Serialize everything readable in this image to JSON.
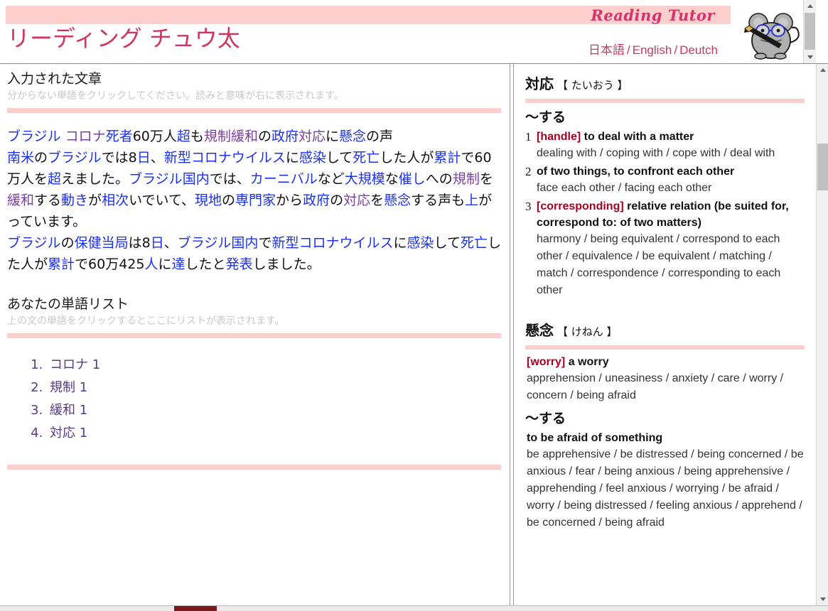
{
  "header": {
    "logo_text": "Reading Tutor",
    "site_title": "リーディング チュウ太",
    "languages": [
      {
        "label": "日本語"
      },
      {
        "label": "English"
      },
      {
        "label": "Deutch"
      }
    ],
    "lang_separator": "/",
    "mascot_name": "mouse-mascot-icon",
    "band_color": "#fbcfcb",
    "title_color": "#d0365f"
  },
  "left": {
    "input_section": {
      "title": "入力された文章",
      "hint": "分からない単語をクリックしてください。読みと意味が右に表示されます。"
    },
    "article": [
      [
        {
          "t": "ブラジル",
          "k": "w"
        },
        {
          "t": " ",
          "k": "p"
        },
        {
          "t": "コロナ",
          "k": "wv"
        },
        {
          "t": "死者",
          "k": "w"
        },
        {
          "t": "60万人",
          "k": "p"
        },
        {
          "t": "超",
          "k": "w"
        },
        {
          "t": "も",
          "k": "p"
        },
        {
          "t": "規制",
          "k": "wv"
        },
        {
          "t": "緩和",
          "k": "wv"
        },
        {
          "t": "の",
          "k": "p"
        },
        {
          "t": "政府",
          "k": "w"
        },
        {
          "t": "対応",
          "k": "wv"
        },
        {
          "t": "に",
          "k": "p"
        },
        {
          "t": "懸念",
          "k": "w"
        },
        {
          "t": "の声",
          "k": "p"
        }
      ],
      [
        {
          "t": "南米",
          "k": "w"
        },
        {
          "t": "の",
          "k": "p"
        },
        {
          "t": "ブラジル",
          "k": "w"
        },
        {
          "t": "では",
          "k": "p"
        },
        {
          "t": "8",
          "k": "p"
        },
        {
          "t": "日",
          "k": "w"
        },
        {
          "t": "、",
          "k": "p"
        },
        {
          "t": "新型",
          "k": "w"
        },
        {
          "t": "コロナウイルス",
          "k": "w"
        },
        {
          "t": "に",
          "k": "p"
        },
        {
          "t": "感染",
          "k": "w"
        },
        {
          "t": "して",
          "k": "p"
        },
        {
          "t": "死亡",
          "k": "w"
        },
        {
          "t": "した人が",
          "k": "p"
        },
        {
          "t": "累計",
          "k": "w"
        },
        {
          "t": "で",
          "k": "p"
        },
        {
          "t": "60万人",
          "k": "p"
        },
        {
          "t": "を",
          "k": "p"
        },
        {
          "t": "超",
          "k": "w"
        },
        {
          "t": "えました。",
          "k": "p"
        },
        {
          "t": "ブラジル",
          "k": "w"
        },
        {
          "t": "国内",
          "k": "w"
        },
        {
          "t": "では、",
          "k": "p"
        },
        {
          "t": "カーニバル",
          "k": "w"
        },
        {
          "t": "など",
          "k": "p"
        },
        {
          "t": "大規模",
          "k": "w"
        },
        {
          "t": "な",
          "k": "p"
        },
        {
          "t": "催し",
          "k": "w"
        },
        {
          "t": "への",
          "k": "p"
        },
        {
          "t": "規制",
          "k": "wv"
        },
        {
          "t": "を",
          "k": "p"
        },
        {
          "t": "緩和",
          "k": "wv"
        },
        {
          "t": "する",
          "k": "p"
        },
        {
          "t": "動き",
          "k": "w"
        },
        {
          "t": "が",
          "k": "p"
        },
        {
          "t": "相次",
          "k": "w"
        },
        {
          "t": "いでいて、",
          "k": "p"
        },
        {
          "t": "現地",
          "k": "w"
        },
        {
          "t": "の",
          "k": "p"
        },
        {
          "t": "専門家",
          "k": "w"
        },
        {
          "t": "から",
          "k": "p"
        },
        {
          "t": "政府",
          "k": "w"
        },
        {
          "t": "の",
          "k": "p"
        },
        {
          "t": "対応",
          "k": "wv"
        },
        {
          "t": "を",
          "k": "p"
        },
        {
          "t": "懸念",
          "k": "w"
        },
        {
          "t": "する声も",
          "k": "p"
        },
        {
          "t": "上",
          "k": "w"
        },
        {
          "t": "がっています。",
          "k": "p"
        }
      ],
      [
        {
          "t": "ブラジル",
          "k": "w"
        },
        {
          "t": "の",
          "k": "p"
        },
        {
          "t": "保健当局",
          "k": "w"
        },
        {
          "t": "は",
          "k": "p"
        },
        {
          "t": "8",
          "k": "p"
        },
        {
          "t": "日",
          "k": "w"
        },
        {
          "t": "、",
          "k": "p"
        },
        {
          "t": "ブラジル",
          "k": "w"
        },
        {
          "t": "国内",
          "k": "w"
        },
        {
          "t": "で",
          "k": "p"
        },
        {
          "t": "新型",
          "k": "w"
        },
        {
          "t": "コロナウイルス",
          "k": "w"
        },
        {
          "t": "に",
          "k": "p"
        },
        {
          "t": "感染",
          "k": "w"
        },
        {
          "t": "して",
          "k": "p"
        },
        {
          "t": "死亡",
          "k": "w"
        },
        {
          "t": "した人が",
          "k": "p"
        },
        {
          "t": "累計",
          "k": "w"
        },
        {
          "t": "で",
          "k": "p"
        },
        {
          "t": "60万425",
          "k": "p"
        },
        {
          "t": "人",
          "k": "w"
        },
        {
          "t": "に",
          "k": "p"
        },
        {
          "t": "達",
          "k": "w"
        },
        {
          "t": "したと",
          "k": "p"
        },
        {
          "t": "発表",
          "k": "w"
        },
        {
          "t": "しました。",
          "k": "p"
        }
      ]
    ],
    "wordlist_section": {
      "title": "あなたの単語リスト",
      "hint": "上の文の単語をクリックするとここにリストが表示されます。"
    },
    "wordlist": [
      {
        "term": "コロナ",
        "count": "1"
      },
      {
        "term": "規制",
        "count": "1"
      },
      {
        "term": "緩和",
        "count": "1"
      },
      {
        "term": "対応",
        "count": "1"
      }
    ]
  },
  "right": {
    "entries": [
      {
        "word": "対応",
        "kana": "【 たいおう 】",
        "groups": [
          {
            "pos": "〜する",
            "senses": [
              {
                "num": "1",
                "tag": "[handle]",
                "gloss": "to deal with a matter",
                "synonyms": "dealing with / coping with / cope with / deal with"
              },
              {
                "num": "2",
                "tag": "",
                "gloss": "of two things, to confront each other",
                "synonyms": "face each other / facing each other"
              },
              {
                "num": "3",
                "tag": "[corresponding]",
                "gloss": "relative relation (be suited for, correspond to: of two matters)",
                "synonyms": "harmony / being equivalent / correspond to each other / equivalence / be equivalent / matching / match / correspondence / corresponding to each other"
              }
            ]
          }
        ]
      },
      {
        "word": "懸念",
        "kana": "【 けねん 】",
        "groups": [
          {
            "pos": "",
            "senses": [
              {
                "num": "",
                "tag": "[worry]",
                "gloss": "a worry",
                "synonyms": "apprehension / uneasiness / anxiety / care / worry / concern / being afraid"
              }
            ]
          },
          {
            "pos": "〜する",
            "senses": [
              {
                "num": "",
                "tag": "",
                "gloss": "to be afraid of something",
                "synonyms": "be apprehensive / be distressed / being concerned / be anxious / fear / being anxious / being apprehensive / apprehending / feel anxious / worrying / be afraid / worry / being distressed / feeling anxious / apprehend / be concerned / being afraid"
              }
            ]
          }
        ]
      }
    ]
  },
  "colors": {
    "pink_rule": "#fbcfcb",
    "link_blue": "#1a31ef",
    "link_visited": "#7b3fa0",
    "tag_red": "#a80020",
    "brand_pink": "#d0365f"
  }
}
